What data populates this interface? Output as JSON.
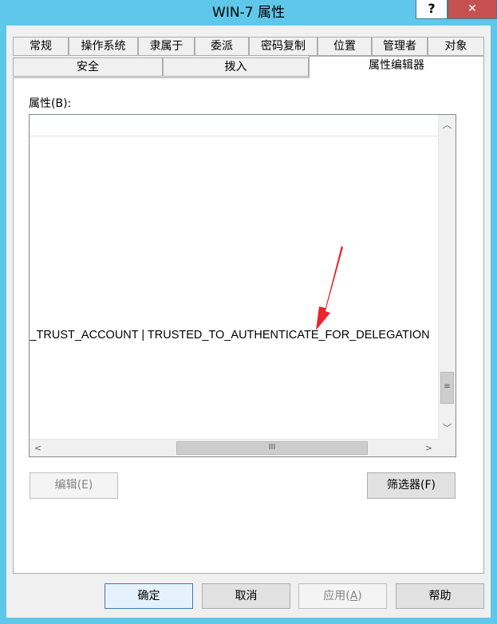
{
  "window": {
    "title": "WIN-7 属性",
    "help_label": "?",
    "close_label": "✕"
  },
  "tabs_row1": [
    "常规",
    "操作系统",
    "隶属于",
    "委派",
    "密码复制",
    "位置",
    "管理者",
    "对象"
  ],
  "tabs_row2": [
    "安全",
    "拨入",
    "属性编辑器"
  ],
  "active_tab": "属性编辑器",
  "attributes": {
    "label": "属性(B):",
    "visible_row_text": "N_TRUST_ACCOUNT | TRUSTED_TO_AUTHENTICATE_FOR_DELEGATION",
    "vscroll_up": "︿",
    "vscroll_down": "﹀",
    "vthumb_grip": "≡",
    "hscroll_left": "<",
    "hscroll_right": ">",
    "hthumb_grip": "III"
  },
  "panel_buttons": {
    "edit": "编辑(E)",
    "filter": "筛选器(F)"
  },
  "dialog_buttons": {
    "ok": "确定",
    "cancel": "取消",
    "apply_prefix": "应用(",
    "apply_key": "A",
    "apply_suffix": ")",
    "help": "帮助"
  },
  "colors": {
    "titlebar": "#5fc7ea",
    "annotation_arrow": "#e8262b"
  }
}
